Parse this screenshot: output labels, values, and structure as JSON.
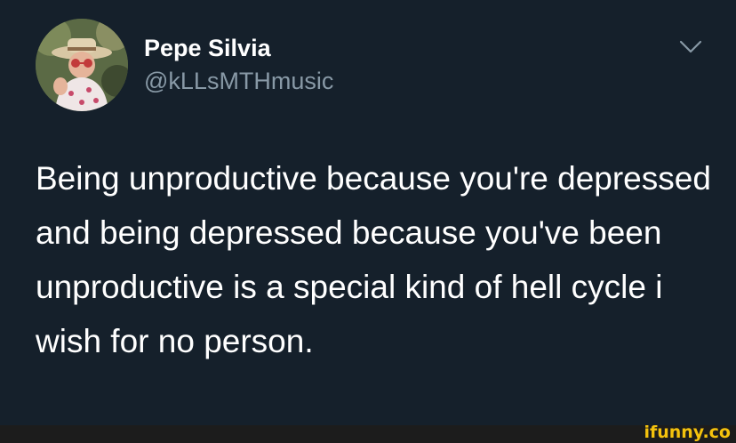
{
  "tweet": {
    "display_name": "Pepe Silvia",
    "handle": "@kLLsMTHmusic",
    "text": "Being unproductive because you're depressed and being depressed because you've been unproductive is a special kind of hell cycle i wish for no person.",
    "menu_icon": "chevron-down-icon",
    "avatar_icon": "avatar-photo"
  },
  "watermark": {
    "text": "ifunny.co"
  },
  "colors": {
    "background": "#15202b",
    "name": "#ffffff",
    "handle": "#8899a6",
    "text": "#ffffff",
    "watermark": "#f4c20d"
  }
}
